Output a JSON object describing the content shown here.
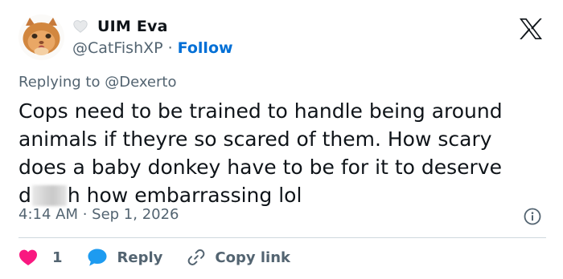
{
  "author": {
    "display_name": "UIM Eva",
    "handle": "@CatFishXP",
    "separator": "·",
    "follow_label": "Follow",
    "avatar_icon": "cat-avatar",
    "badge_icon": "heart-outline-icon"
  },
  "reply_context": {
    "prefix": "Replying to ",
    "mention": "@Dexerto"
  },
  "tweet": {
    "line1": "Cops need to be trained to handle being around",
    "line2": "animals if theyre so scared of them. How scary",
    "line3": "does a baby donkey have to be for it to deserve",
    "line4_start": "d",
    "line4_end": "h how embarrassing lol",
    "timestamp": "4:14 AM · Sep 1, 2026"
  },
  "actions": {
    "like_count": "1",
    "reply_label": "Reply",
    "copy_link_label": "Copy link"
  },
  "colors": {
    "text": "#0f1419",
    "secondary": "#536471",
    "follow": "#006fd6",
    "like": "#f91880",
    "reply": "#1d9bf0",
    "divider": "#cfd9de"
  }
}
